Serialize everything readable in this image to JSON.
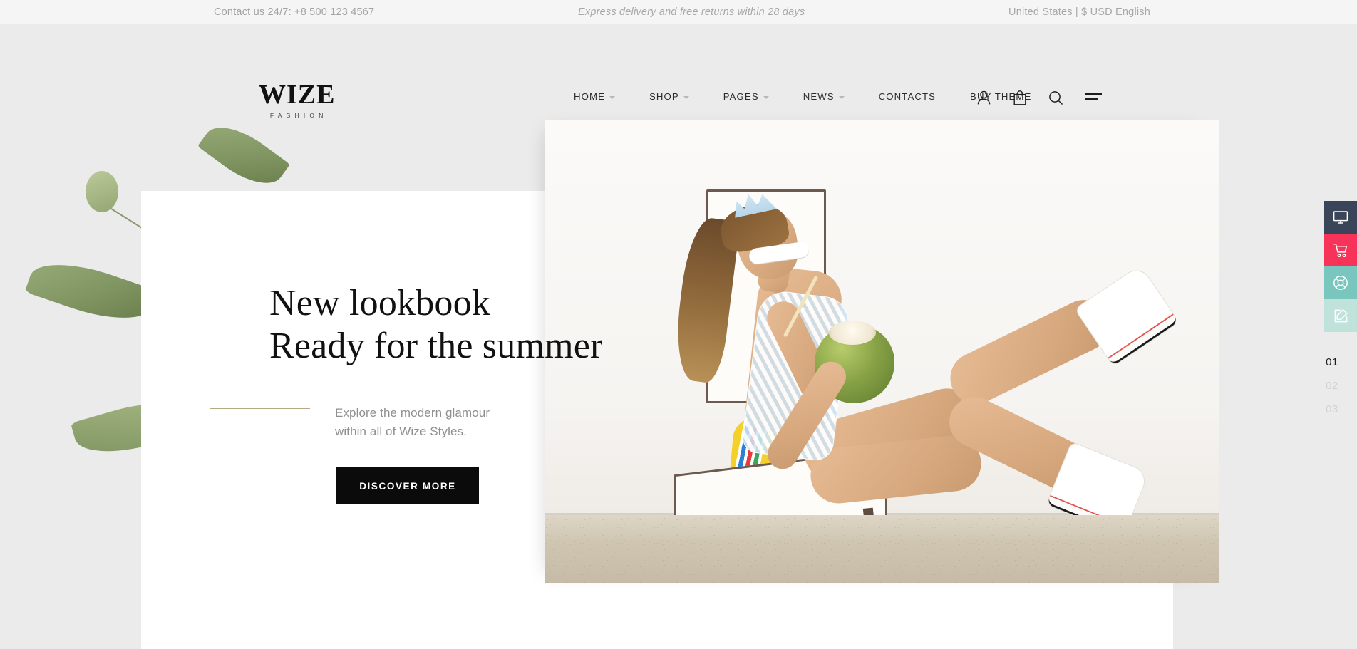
{
  "topbar": {
    "contact": "Contact us 24/7: +8 500 123 4567",
    "promo": "Express delivery and free returns within 28 days",
    "locale": "United States | $ USD English"
  },
  "header": {
    "logo_word": "WIZE",
    "logo_sub": "FASHION",
    "nav": [
      {
        "label": "HOME",
        "has_dropdown": true
      },
      {
        "label": "SHOP",
        "has_dropdown": true
      },
      {
        "label": "PAGES",
        "has_dropdown": true
      },
      {
        "label": "NEWS",
        "has_dropdown": true
      },
      {
        "label": "CONTACTS",
        "has_dropdown": false
      },
      {
        "label": "BUY THEME",
        "has_dropdown": false
      }
    ],
    "icons": [
      {
        "name": "account-icon"
      },
      {
        "name": "shopping-bag-icon"
      },
      {
        "name": "search-icon"
      },
      {
        "name": "hamburger-menu-icon"
      }
    ]
  },
  "hero": {
    "headline_line1": "New lookbook",
    "headline_line2": "Ready for the summer",
    "lead_line1": "Explore the modern glamour",
    "lead_line2": "within all of Wize Styles.",
    "cta_label": "DISCOVER MORE"
  },
  "toolstrip": [
    {
      "name": "demo-monitor-button",
      "color": "#3b4559"
    },
    {
      "name": "cart-button",
      "color": "#f8335a"
    },
    {
      "name": "support-lifering-button",
      "color": "#79c6bf"
    },
    {
      "name": "customize-edit-button",
      "color": "#bfe3db"
    }
  ],
  "slides": [
    {
      "label": "01",
      "active": true
    },
    {
      "label": "02",
      "active": false
    },
    {
      "label": "03",
      "active": false
    }
  ],
  "colors": {
    "page_bg": "#ebebeb",
    "topbar_bg": "#f5f5f5",
    "panel_bg": "#ffffff",
    "accent_rule": "#b6a882",
    "cta_bg": "#0b0b0b"
  }
}
